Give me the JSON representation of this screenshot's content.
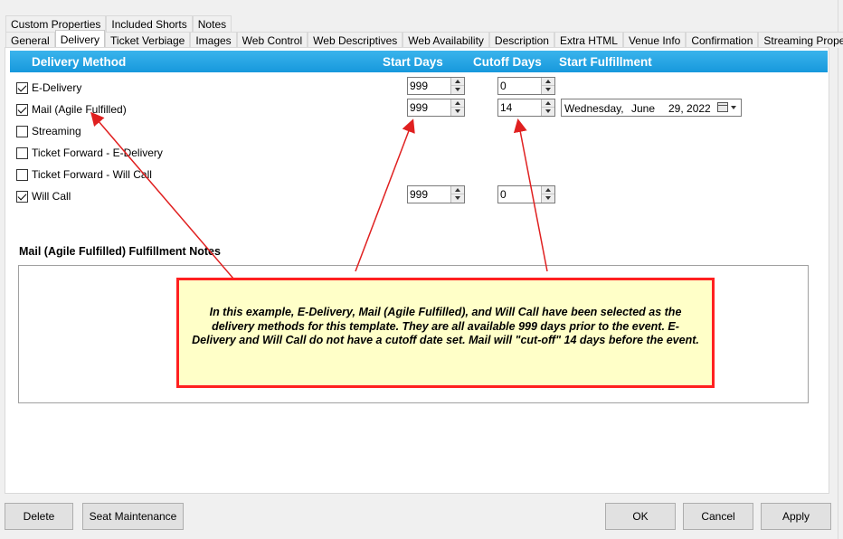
{
  "tabs_row1": [
    "Custom Properties",
    "Included Shorts",
    "Notes"
  ],
  "tabs_row2": [
    "General",
    "Delivery",
    "Ticket Verbiage",
    "Images",
    "Web Control",
    "Web Descriptives",
    "Web Availability",
    "Description",
    "Extra HTML",
    "Venue Info",
    "Confirmation",
    "Streaming Properties"
  ],
  "active_tab": "Delivery",
  "header": {
    "delivery_method": "Delivery Method",
    "start_days": "Start Days",
    "cutoff_days": "Cutoff Days",
    "start_fulfillment": "Start Fulfillment"
  },
  "methods": [
    {
      "label": "E-Delivery",
      "checked": true,
      "start_days": "999",
      "cutoff_days": "0"
    },
    {
      "label": "Mail (Agile Fulfilled)",
      "checked": true,
      "start_days": "999",
      "cutoff_days": "14"
    },
    {
      "label": "Streaming",
      "checked": false
    },
    {
      "label": "Ticket Forward - E-Delivery",
      "checked": false
    },
    {
      "label": "Ticket Forward - Will Call",
      "checked": false
    },
    {
      "label": "Will Call",
      "checked": true,
      "start_days": "999",
      "cutoff_days": "0"
    }
  ],
  "start_fulfillment_date": {
    "weekday": "Wednesday,",
    "month": "June",
    "day_year": "29, 2022"
  },
  "notes": {
    "title": "Mail (Agile Fulfilled) Fulfillment Notes",
    "value": ""
  },
  "callout_text": "In this example, E-Delivery, Mail (Agile Fulfilled), and Will Call have been selected as the delivery methods for this template.  They are all available 999 days prior to the event.  E-Delivery and Will Call do not have a cutoff date set.  Mail will \"cut-off\" 14 days before the event.",
  "buttons": {
    "delete": "Delete",
    "seat_maintenance": "Seat Maintenance",
    "ok": "OK",
    "cancel": "Cancel",
    "apply": "Apply"
  },
  "colors": {
    "header_bar": "#1e9fe0",
    "callout_border": "#ff2020",
    "callout_bg": "#ffffc8",
    "arrow": "#e02020"
  }
}
